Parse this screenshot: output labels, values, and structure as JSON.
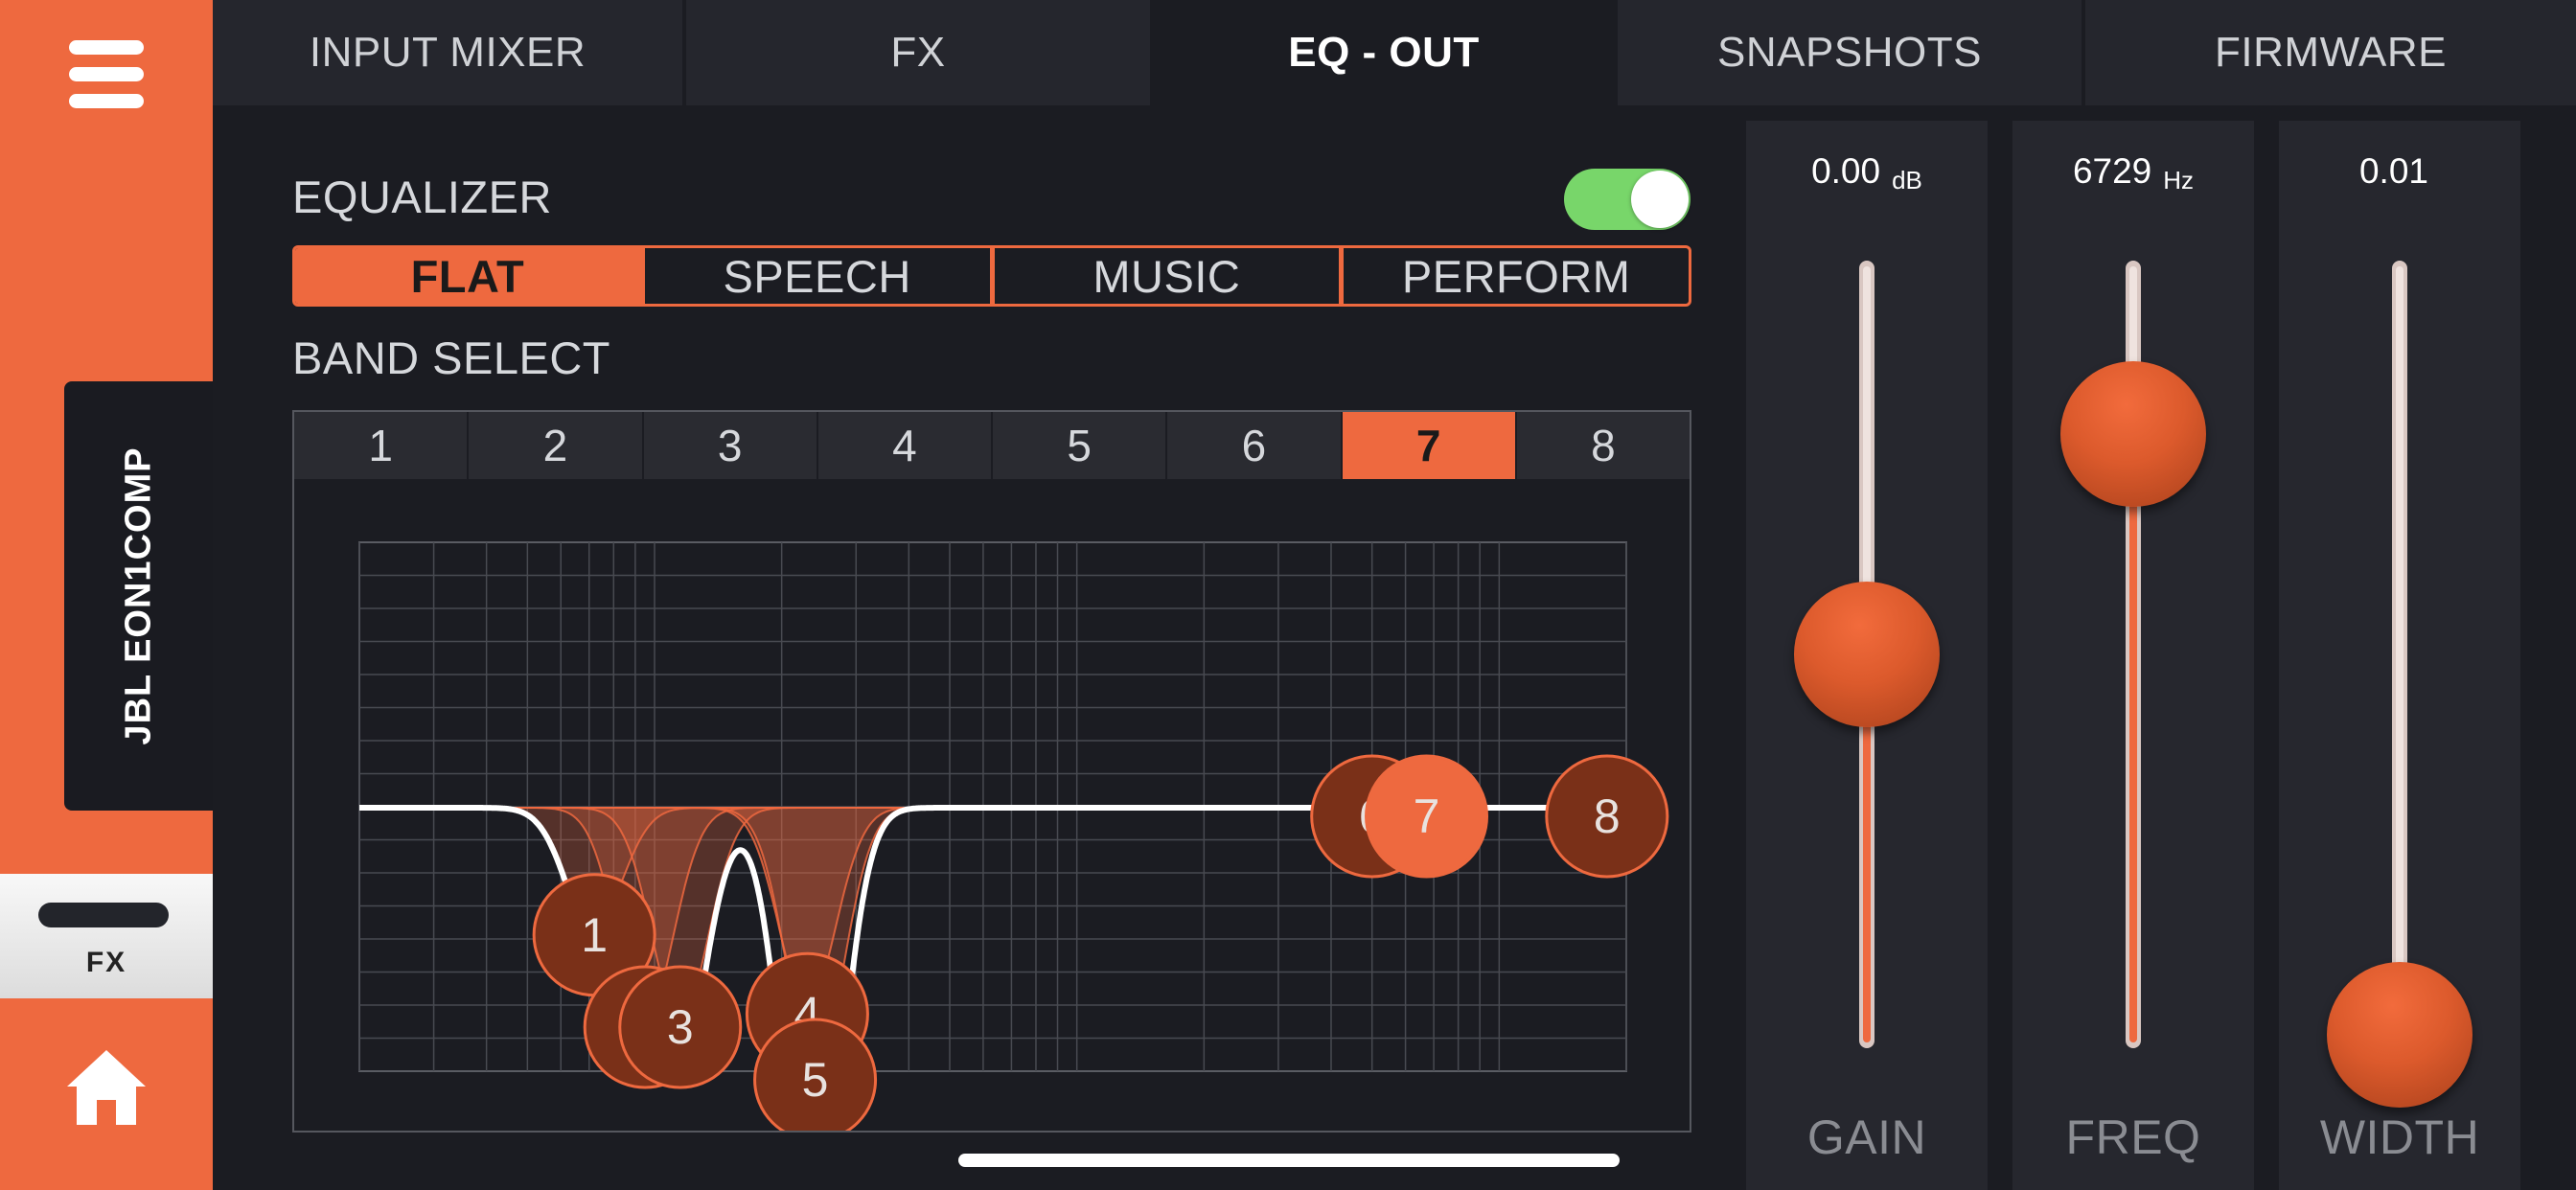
{
  "sidebar": {
    "device_name": "JBL EON1COMP",
    "fx_label": "FX"
  },
  "tabs": [
    {
      "label": "INPUT MIXER",
      "active": false
    },
    {
      "label": "FX",
      "active": false
    },
    {
      "label": "EQ - OUT",
      "active": true
    },
    {
      "label": "SNAPSHOTS",
      "active": false
    },
    {
      "label": "FIRMWARE",
      "active": false
    }
  ],
  "equalizer": {
    "title": "EQUALIZER",
    "enabled": true,
    "presets": [
      {
        "label": "FLAT",
        "active": true
      },
      {
        "label": "SPEECH",
        "active": false
      },
      {
        "label": "MUSIC",
        "active": false
      },
      {
        "label": "PERFORM",
        "active": false
      }
    ],
    "band_select_title": "BAND SELECT",
    "bands": [
      "1",
      "2",
      "3",
      "4",
      "5",
      "6",
      "7",
      "8"
    ],
    "selected_band": "7",
    "band_nodes": [
      {
        "label": "1",
        "freq": 72,
        "gain": -4.5
      },
      {
        "label": "2",
        "freq": 95,
        "gain": -8
      },
      {
        "label": "3",
        "freq": 115,
        "gain": -8
      },
      {
        "label": "4",
        "freq": 230,
        "gain": -7.5
      },
      {
        "label": "5",
        "freq": 240,
        "gain": -10
      },
      {
        "label": "6",
        "freq": 5000,
        "gain": 0
      },
      {
        "label": "7",
        "freq": 6729,
        "gain": 0
      },
      {
        "label": "8",
        "freq": 18000,
        "gain": 0
      }
    ]
  },
  "controls": {
    "gain": {
      "label": "GAIN",
      "value": "0.00",
      "unit": "dB",
      "level": 0.5
    },
    "freq": {
      "label": "FREQ",
      "value": "6729",
      "unit": "Hz",
      "level": 0.79
    },
    "width": {
      "label": "WIDTH",
      "value": "0.01",
      "unit": "",
      "level": 0.0
    }
  },
  "colors": {
    "accent": "#ee693f",
    "background": "#1b1c22",
    "panel": "#26272e",
    "toggle_on": "#78d66a",
    "node_fill": "#7a3018",
    "curve": "#ffffff"
  },
  "icons": {
    "menu": "hamburger-menu-icon",
    "home": "home-icon"
  }
}
